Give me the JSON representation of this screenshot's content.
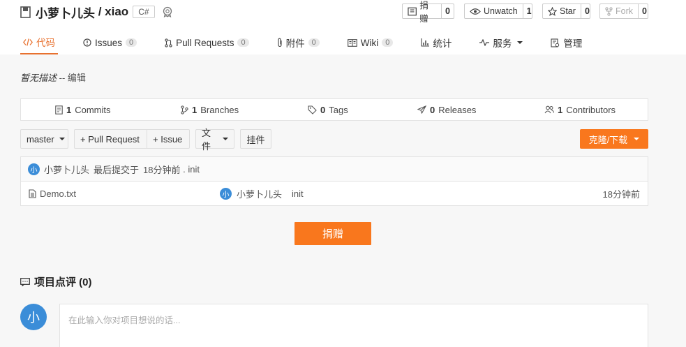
{
  "repo": {
    "owner": "小萝卜儿头",
    "sep": " / ",
    "name": "xiao",
    "language": "C#"
  },
  "actions": {
    "donate": {
      "label": "捐赠",
      "count": "0"
    },
    "watch": {
      "label": "Unwatch",
      "count": "1"
    },
    "star": {
      "label": "Star",
      "count": "0"
    },
    "fork": {
      "label": "Fork",
      "count": "0"
    }
  },
  "tabs": [
    {
      "label": "代码"
    },
    {
      "label": "Issues",
      "count": "0"
    },
    {
      "label": "Pull Requests",
      "count": "0"
    },
    {
      "label": "附件",
      "count": "0"
    },
    {
      "label": "Wiki",
      "count": "0"
    },
    {
      "label": "统计"
    },
    {
      "label": "服务"
    },
    {
      "label": "管理"
    }
  ],
  "description": {
    "text": "暂无描述",
    "sep": " -- ",
    "edit": "编辑"
  },
  "stats": [
    {
      "num": "1",
      "label": "Commits"
    },
    {
      "num": "1",
      "label": "Branches"
    },
    {
      "num": "0",
      "label": "Tags"
    },
    {
      "num": "0",
      "label": "Releases"
    },
    {
      "num": "1",
      "label": "Contributors"
    }
  ],
  "toolbar": {
    "branch": "master",
    "pull_request": "+ Pull Request",
    "issue": "+ Issue",
    "files": "文件",
    "widget": "挂件",
    "clone": "克隆/下载"
  },
  "commit": {
    "avatar_char": "小",
    "author": "小萝卜儿头",
    "text": "最后提交于",
    "time": "18分钟前",
    "sep": " . ",
    "message": "init"
  },
  "files": [
    {
      "name": "Demo.txt",
      "avatar_char": "小",
      "author": "小萝卜儿头",
      "message": "init",
      "time": "18分钟前"
    }
  ],
  "donate_button": "捐赠",
  "review": {
    "title": "项目点评 (0)",
    "avatar_char": "小",
    "placeholder": "在此输入你对项目想说的话..."
  },
  "colors": {
    "accent": "#f9771d",
    "avatar": "#3b8dd8"
  }
}
